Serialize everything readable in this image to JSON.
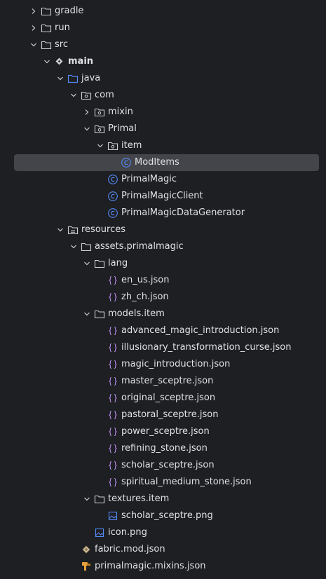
{
  "tree": [
    {
      "label": "gradle",
      "depth": 0,
      "chevron": "right",
      "icon": "folder-icon"
    },
    {
      "label": "run",
      "depth": 0,
      "chevron": "right",
      "icon": "folder-icon"
    },
    {
      "label": "src",
      "depth": 0,
      "chevron": "down",
      "icon": "folder-icon"
    },
    {
      "label": "main",
      "depth": 1,
      "chevron": "down",
      "icon": "module-source-icon",
      "bold": true
    },
    {
      "label": "java",
      "depth": 2,
      "chevron": "down",
      "icon": "source-folder-icon"
    },
    {
      "label": "com",
      "depth": 3,
      "chevron": "down",
      "icon": "package-icon"
    },
    {
      "label": "mixin",
      "depth": 4,
      "chevron": "right",
      "icon": "package-icon"
    },
    {
      "label": "Primal",
      "depth": 4,
      "chevron": "down",
      "icon": "package-icon"
    },
    {
      "label": "item",
      "depth": 5,
      "chevron": "down",
      "icon": "package-icon"
    },
    {
      "label": "ModItems",
      "depth": 6,
      "chevron": "none",
      "icon": "java-class-icon",
      "selected": true
    },
    {
      "label": "PrimalMagic",
      "depth": 5,
      "chevron": "none",
      "icon": "java-class-icon"
    },
    {
      "label": "PrimalMagicClient",
      "depth": 5,
      "chevron": "none",
      "icon": "java-class-icon"
    },
    {
      "label": "PrimalMagicDataGenerator",
      "depth": 5,
      "chevron": "none",
      "icon": "java-class-icon"
    },
    {
      "label": "resources",
      "depth": 2,
      "chevron": "down",
      "icon": "resources-folder-icon"
    },
    {
      "label": "assets.primalmagic",
      "depth": 3,
      "chevron": "down",
      "icon": "folder-icon"
    },
    {
      "label": "lang",
      "depth": 4,
      "chevron": "down",
      "icon": "folder-icon"
    },
    {
      "label": "en_us.json",
      "depth": 5,
      "chevron": "none",
      "icon": "json-file-icon"
    },
    {
      "label": "zh_ch.json",
      "depth": 5,
      "chevron": "none",
      "icon": "json-file-icon"
    },
    {
      "label": "models.item",
      "depth": 4,
      "chevron": "down",
      "icon": "folder-icon"
    },
    {
      "label": "advanced_magic_introduction.json",
      "depth": 5,
      "chevron": "none",
      "icon": "json-file-icon"
    },
    {
      "label": "illusionary_transformation_curse.json",
      "depth": 5,
      "chevron": "none",
      "icon": "json-file-icon"
    },
    {
      "label": "magic_introduction.json",
      "depth": 5,
      "chevron": "none",
      "icon": "json-file-icon"
    },
    {
      "label": "master_sceptre.json",
      "depth": 5,
      "chevron": "none",
      "icon": "json-file-icon"
    },
    {
      "label": "original_sceptre.json",
      "depth": 5,
      "chevron": "none",
      "icon": "json-file-icon"
    },
    {
      "label": "pastoral_sceptre.json",
      "depth": 5,
      "chevron": "none",
      "icon": "json-file-icon"
    },
    {
      "label": "power_sceptre.json",
      "depth": 5,
      "chevron": "none",
      "icon": "json-file-icon"
    },
    {
      "label": "refining_stone.json",
      "depth": 5,
      "chevron": "none",
      "icon": "json-file-icon"
    },
    {
      "label": "scholar_sceptre.json",
      "depth": 5,
      "chevron": "none",
      "icon": "json-file-icon"
    },
    {
      "label": "spiritual_medium_stone.json",
      "depth": 5,
      "chevron": "none",
      "icon": "json-file-icon"
    },
    {
      "label": "textures.item",
      "depth": 4,
      "chevron": "down",
      "icon": "folder-icon"
    },
    {
      "label": "scholar_sceptre.png",
      "depth": 5,
      "chevron": "none",
      "icon": "image-file-icon"
    },
    {
      "label": "icon.png",
      "depth": 4,
      "chevron": "none",
      "icon": "image-file-icon"
    },
    {
      "label": "fabric.mod.json",
      "depth": 3,
      "chevron": "none",
      "icon": "fabric-mod-icon"
    },
    {
      "label": "primalmagic.mixins.json",
      "depth": 3,
      "chevron": "none",
      "icon": "mixin-json-icon"
    }
  ],
  "colors": {
    "background": "#1e1f22",
    "selected_row": "#43454a",
    "text": "#dfe1e5",
    "folder_stroke": "#ced0d6",
    "source_folder": "#548af7",
    "java_class": "#548af7",
    "json_icon": "#b389e6",
    "image_icon": "#548af7",
    "mixin_icon": "#e8a33d"
  }
}
